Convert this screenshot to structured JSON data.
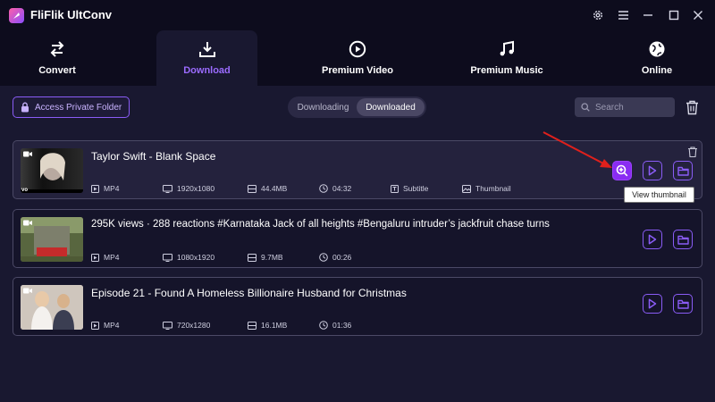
{
  "app": {
    "title": "FliFlik UltConv"
  },
  "tabs": [
    {
      "label": "Convert",
      "icon": "swap-arrows-icon"
    },
    {
      "label": "Download",
      "icon": "download-tray-icon",
      "active": true
    },
    {
      "label": "Premium Video",
      "icon": "play-circle-icon"
    },
    {
      "label": "Premium Music",
      "icon": "music-note-icon"
    },
    {
      "label": "Online",
      "icon": "globe-icon"
    }
  ],
  "toolbar": {
    "private_folder_label": "Access Private Folder",
    "segments": [
      "Downloading",
      "Downloaded"
    ],
    "active_segment": "Downloaded",
    "search_placeholder": "Search"
  },
  "items": [
    {
      "title": "Taylor Swift - Blank Space",
      "format": "MP4",
      "resolution": "1920x1080",
      "size": "44.4MB",
      "duration": "04:32",
      "subtitle_label": "Subtitle",
      "thumbnail_label": "Thumbnail",
      "thumb_badge": "vo"
    },
    {
      "title": "295K views · 288 reactions #Karnataka Jack of all heights #Bengaluru intruder’s jackfruit chase turns",
      "format": "MP4",
      "resolution": "1080x1920",
      "size": "9.7MB",
      "duration": "00:26"
    },
    {
      "title": "Episode 21 - Found A Homeless Billionaire Husband for Christmas",
      "format": "MP4",
      "resolution": "720x1280",
      "size": "16.1MB",
      "duration": "01:36"
    }
  ],
  "tooltip": "View thumbnail",
  "colors": {
    "accent": "#8a5cf6",
    "accent_solid": "#8a2cf2",
    "annotation_arrow": "#e0201c"
  }
}
